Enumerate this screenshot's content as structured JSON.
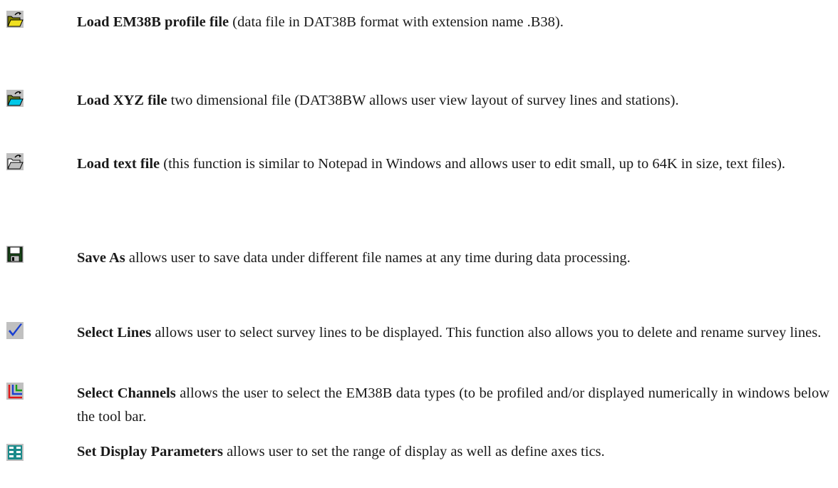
{
  "items": [
    {
      "icon": "open-folder-icon",
      "title": "Load EM38B profile file",
      "text": " (data file in DAT38B format with extension name .B38)."
    },
    {
      "icon": "open-folder-cyan-icon",
      "title": "Load XYZ file",
      "text": " two dimensional file (DAT38BW allows user view layout of survey lines and stations)."
    },
    {
      "icon": "open-folder-gray-icon",
      "title": "Load text file",
      "text": " (this function is similar to Notepad in Windows and allows user to edit small, up to 64K in size, text files)."
    },
    {
      "icon": "save-disk-icon",
      "title": "Save As",
      "text": " allows user to save data under different file names at any time during data processing."
    },
    {
      "icon": "checkmark-icon",
      "title": "Select Lines",
      "text": " allows user to select survey lines to be displayed.  This function also allows you to delete and rename survey lines."
    },
    {
      "icon": "channels-icon",
      "title": "Select Channels",
      "text": " allows the user to select the EM38B data types (to be profiled and/or displayed numerically in windows below the tool bar."
    },
    {
      "icon": "display-parameters-icon",
      "title": "Set Display Parameters",
      "text": " allows user to set the range of display as well as define axes tics."
    }
  ],
  "colors": {
    "folder_yellow": "#f0e020",
    "folder_olive": "#8a8a00",
    "folder_cyan": "#00c8e8",
    "disk_green": "#184818",
    "check_blue": "#1a3fd0",
    "channel_red": "#e01818",
    "channel_blue": "#1a3fd0",
    "grid_teal": "#1a8a8a"
  }
}
